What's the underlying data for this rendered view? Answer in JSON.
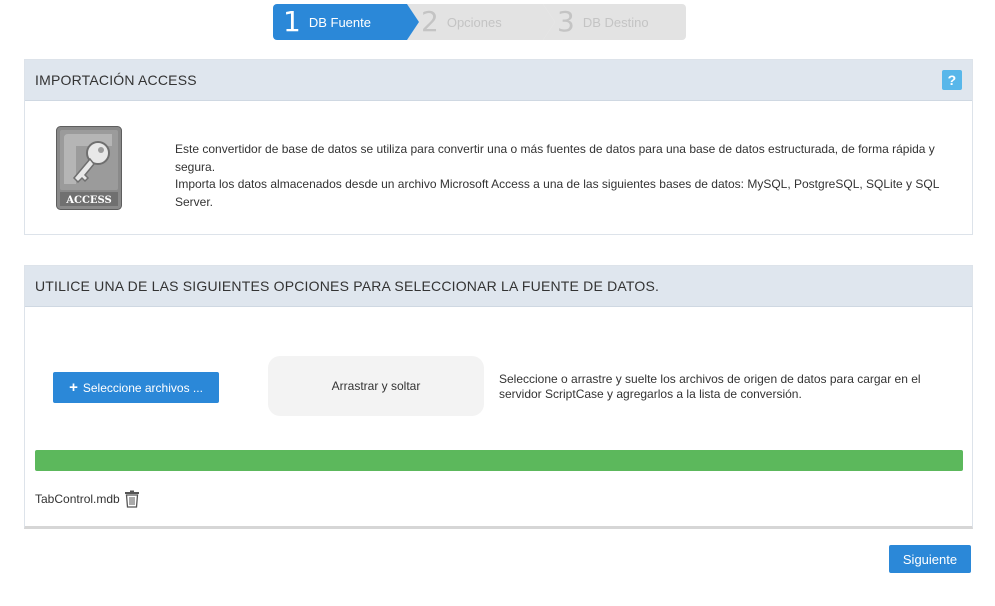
{
  "wizard": {
    "steps": [
      {
        "number": "1",
        "label": "DB Fuente",
        "state": "active"
      },
      {
        "number": "2",
        "label": "Opciones",
        "state": "inactive"
      },
      {
        "number": "3",
        "label": "DB Destino",
        "state": "inactive"
      }
    ]
  },
  "import_panel": {
    "title": "IMPORTACIÓN ACCESS",
    "help_icon": "question-icon",
    "help_label": "?",
    "logo_text": "ACCESS",
    "description_1": "Este convertidor de base de datos se utiliza para convertir una o más fuentes de datos para una base de datos estructurada, de forma rápida y segura.",
    "description_2": "Importa los datos almacenados desde un archivo Microsoft Access a una de las siguientes bases de datos: MySQL, PostgreSQL, SQLite y SQL Server."
  },
  "source_panel": {
    "title": "UTILICE UNA DE LAS SIGUIENTES OPCIONES PARA SELECCIONAR LA FUENTE DE DATOS.",
    "select_button_icon": "plus-icon",
    "select_button_label": "Seleccione archivos ...",
    "drop_zone_label": "Arrastrar y soltar",
    "hint": "Seleccione o arrastre y suelte los archivos de origen de datos para cargar en el servidor ScriptCase y agregarlos a la lista de conversión.",
    "progress": 1.0,
    "files": [
      {
        "name": "TabControl.mdb",
        "action_icon": "trash-icon"
      }
    ]
  },
  "footer": {
    "next_label": "Siguiente"
  },
  "colors": {
    "accent": "#2b88d8",
    "progress": "#5cb85c",
    "help": "#58b7ea",
    "panel_header": "#dfe6ee"
  }
}
